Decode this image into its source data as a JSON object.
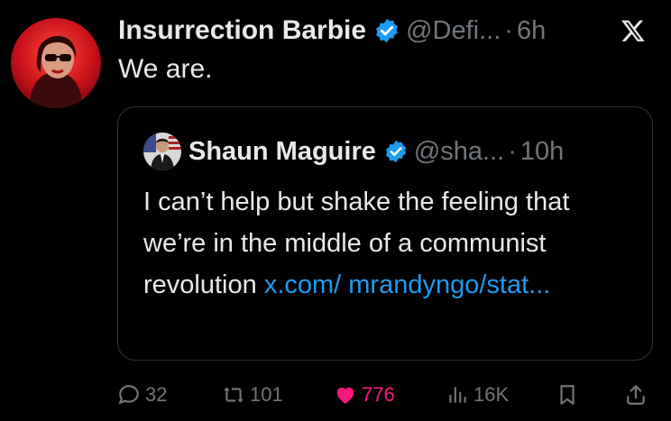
{
  "tweet": {
    "author_name": "Insurrection Barbie",
    "handle": "@Defi...",
    "time_sep": "·",
    "time": "6h",
    "text": "We are."
  },
  "quoted": {
    "author_name": "Shaun Maguire",
    "handle": "@sha...",
    "time_sep": "·",
    "time": "10h",
    "text": "I can’t help but shake the feeling that we’re in the middle of a communist revolution ",
    "link_text": "x.com/ mrandyngo/stat..."
  },
  "actions": {
    "replies": "32",
    "reposts": "101",
    "likes": "776",
    "views": "16K"
  },
  "colors": {
    "background": "#000000",
    "text": "#e7e9ea",
    "muted": "#71767b",
    "link": "#1d9bf0",
    "like": "#f91880",
    "verified": "#1d9bf0"
  },
  "icons": [
    "x-logo-icon",
    "verified-icon",
    "reply-icon",
    "repost-icon",
    "like-icon",
    "views-icon",
    "bookmark-icon",
    "share-icon"
  ]
}
